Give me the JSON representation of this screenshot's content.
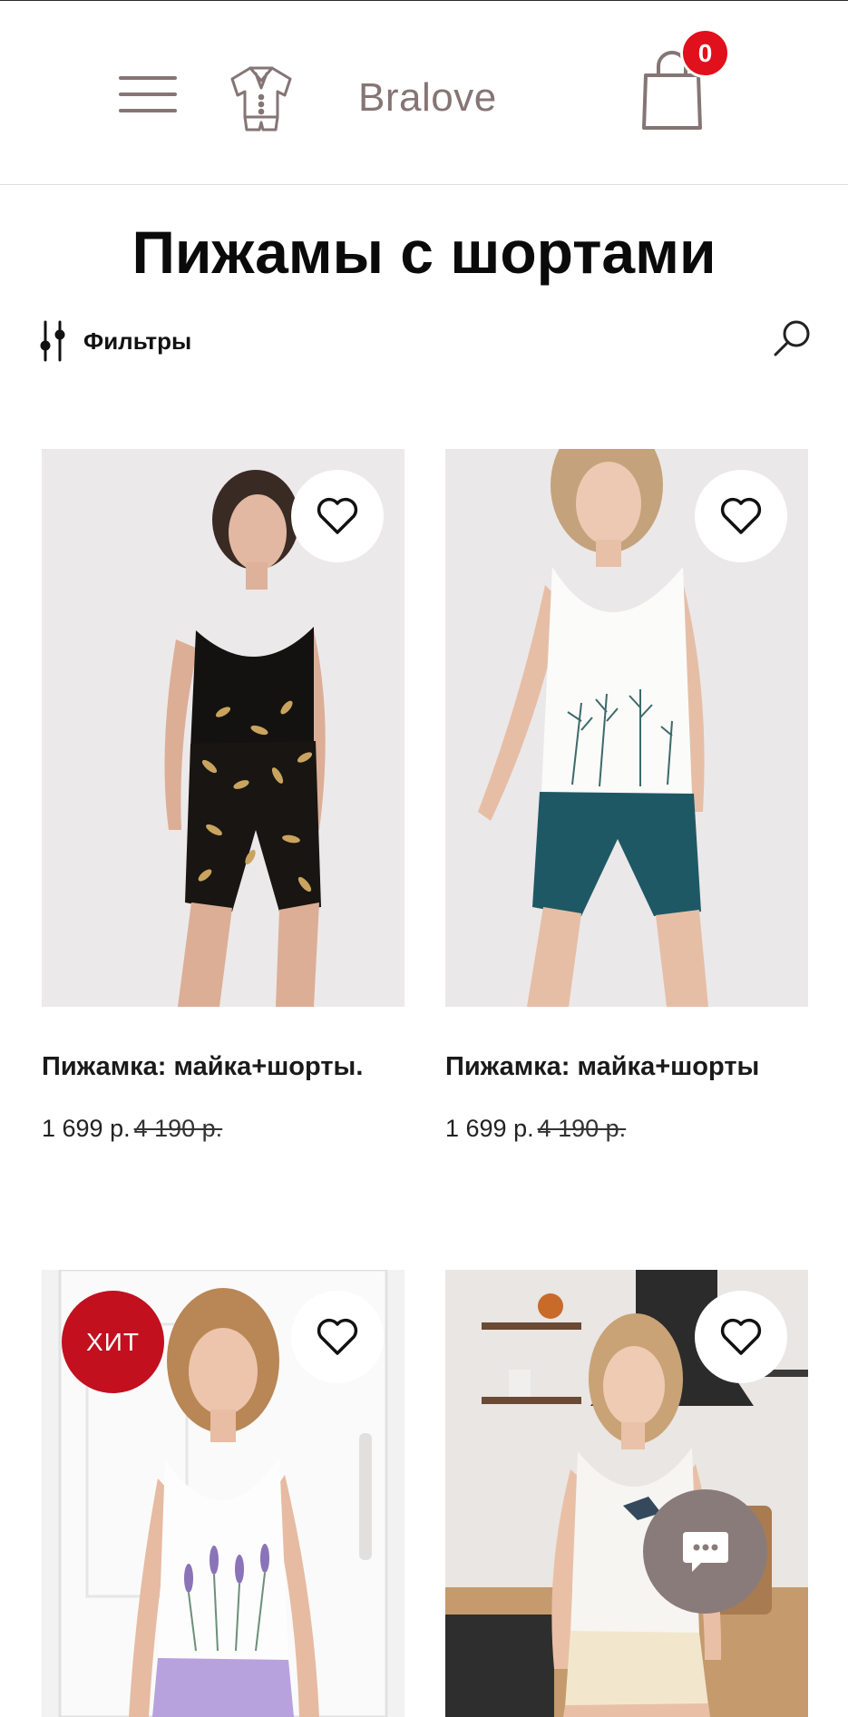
{
  "header": {
    "brand": "Bralove",
    "cart_count": "0"
  },
  "page": {
    "title": "Пижамы с шортами",
    "filters_label": "Фильтры"
  },
  "products": [
    {
      "name": "Пижамка: майка+шорты.",
      "price": "1 699 р.",
      "old_price": "4 190 р.",
      "badge": ""
    },
    {
      "name": "Пижамка: майка+шорты",
      "price": "1 699 р.",
      "old_price": "4 190 р.",
      "badge": ""
    },
    {
      "name": "",
      "price": "",
      "old_price": "",
      "badge": "ХИТ"
    },
    {
      "name": "",
      "price": "",
      "old_price": "",
      "badge": ""
    }
  ],
  "icons": {
    "menu": "menu-icon",
    "logo": "pajama-icon",
    "cart": "shopping-bag-icon",
    "filters": "filter-sliders-icon",
    "search": "search-icon",
    "favorite": "heart-icon",
    "chat": "chat-icon"
  },
  "colors": {
    "accent_brown": "#857575",
    "badge_red": "#e0101c",
    "hit_red": "#c2101f",
    "chat_bg": "#8a7b7b"
  }
}
